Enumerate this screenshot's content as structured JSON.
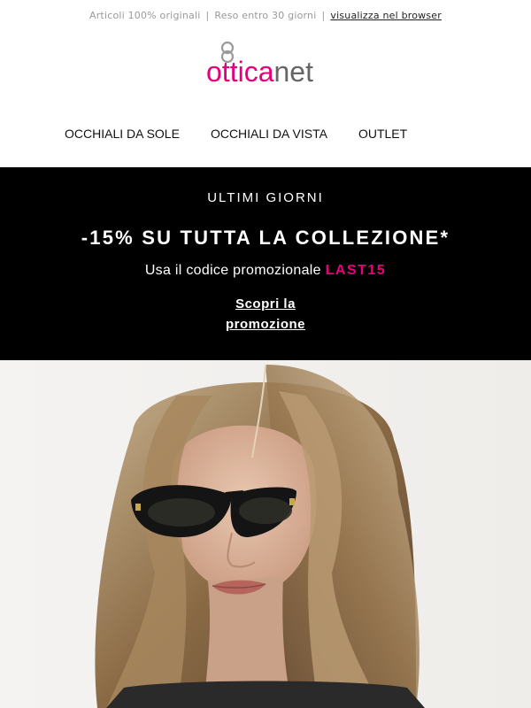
{
  "topbar": {
    "items": [
      "Articoli 100% originali",
      "Reso entro 30 giorni"
    ],
    "separator": "|",
    "browser_link": "visualizza nel browser"
  },
  "logo": {
    "part1": "ottica",
    "part2": "net",
    "accent_color": "#e6007e",
    "text_color": "#666666"
  },
  "nav": {
    "items": [
      "OCCHIALI DA SOLE",
      "OCCHIALI DA VISTA",
      "OUTLET"
    ]
  },
  "promo": {
    "eyebrow": "ULTIMI GIORNI",
    "headline": "-15% SU TUTTA LA COLLEZIONE*",
    "code_prefix": "Usa il codice promozionale",
    "code": "LAST15",
    "cta_line1": "Scopri la",
    "cta_line2": "promozione",
    "background": "#000000",
    "code_color": "#e6007e"
  },
  "hero": {
    "image_subject": "woman-wearing-black-oval-sunglasses"
  }
}
